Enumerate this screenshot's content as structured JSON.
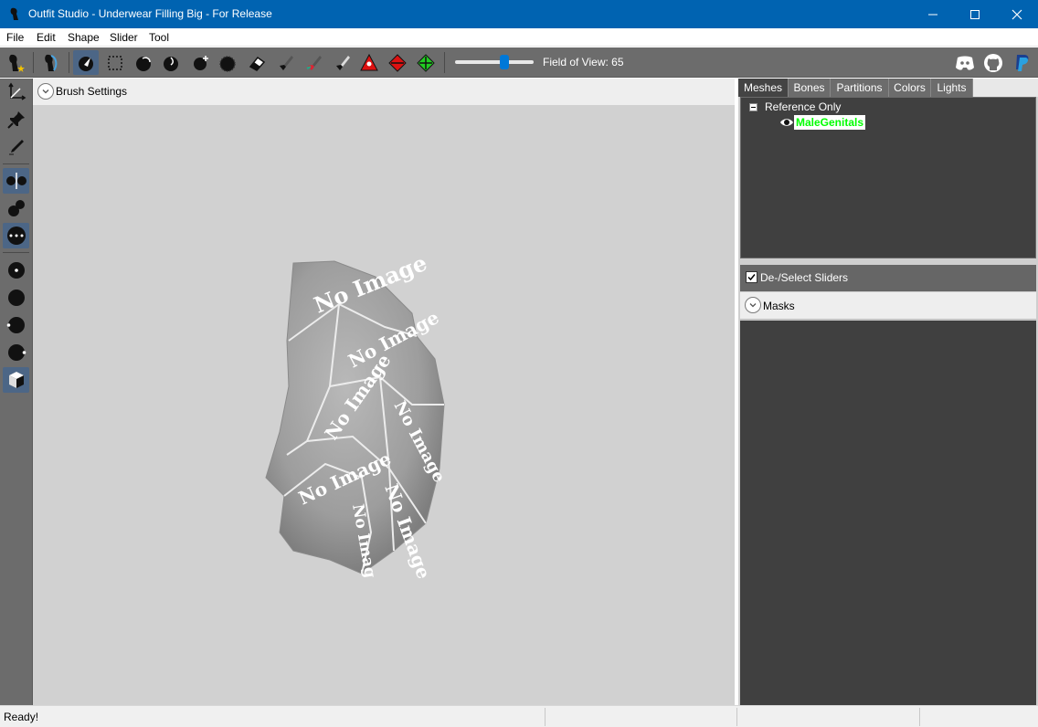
{
  "window": {
    "title": "Outfit Studio - Underwear Filling Big - For Release",
    "minimize_icon": "minimize-icon",
    "maximize_icon": "maximize-icon",
    "close_icon": "close-icon"
  },
  "menu": {
    "items": [
      "File",
      "Edit",
      "Shape",
      "Slider",
      "Tool"
    ]
  },
  "toolbar": {
    "fov_label": "Field of View: 65",
    "fov_value": 65,
    "fov_min": 0,
    "fov_max": 100,
    "icons": [
      "new-project-icon",
      "load-outfit-icon",
      "select-brush-icon",
      "transform-icon",
      "inflate-brush-icon",
      "deflate-brush-icon",
      "move-brush-icon",
      "smooth-brush-icon",
      "undiff-brush-icon",
      "weight-paint-icon",
      "color-paint-icon",
      "alpha-paint-icon",
      "collapse-vertex-icon",
      "flip-edge-icon",
      "split-edge-icon",
      "discord-icon",
      "github-icon",
      "paypal-icon"
    ]
  },
  "canvas": {
    "brush_settings_label": "Brush Settings",
    "texture_text": "No Image"
  },
  "panel": {
    "tabs": [
      "Meshes",
      "Bones",
      "Partitions",
      "Colors",
      "Lights"
    ],
    "active_tab": "Meshes",
    "tree": {
      "group_label": "Reference Only",
      "mesh_label": "MaleGenitals"
    },
    "sliders_label": "De-/Select Sliders",
    "masks_label": "Masks"
  },
  "status": {
    "text": "Ready!"
  },
  "colors": {
    "titlebar": "#0063b1",
    "toolbar": "#6c6c6c",
    "active_tool": "#4c6686",
    "mesh_highlight": "#00ff00"
  }
}
